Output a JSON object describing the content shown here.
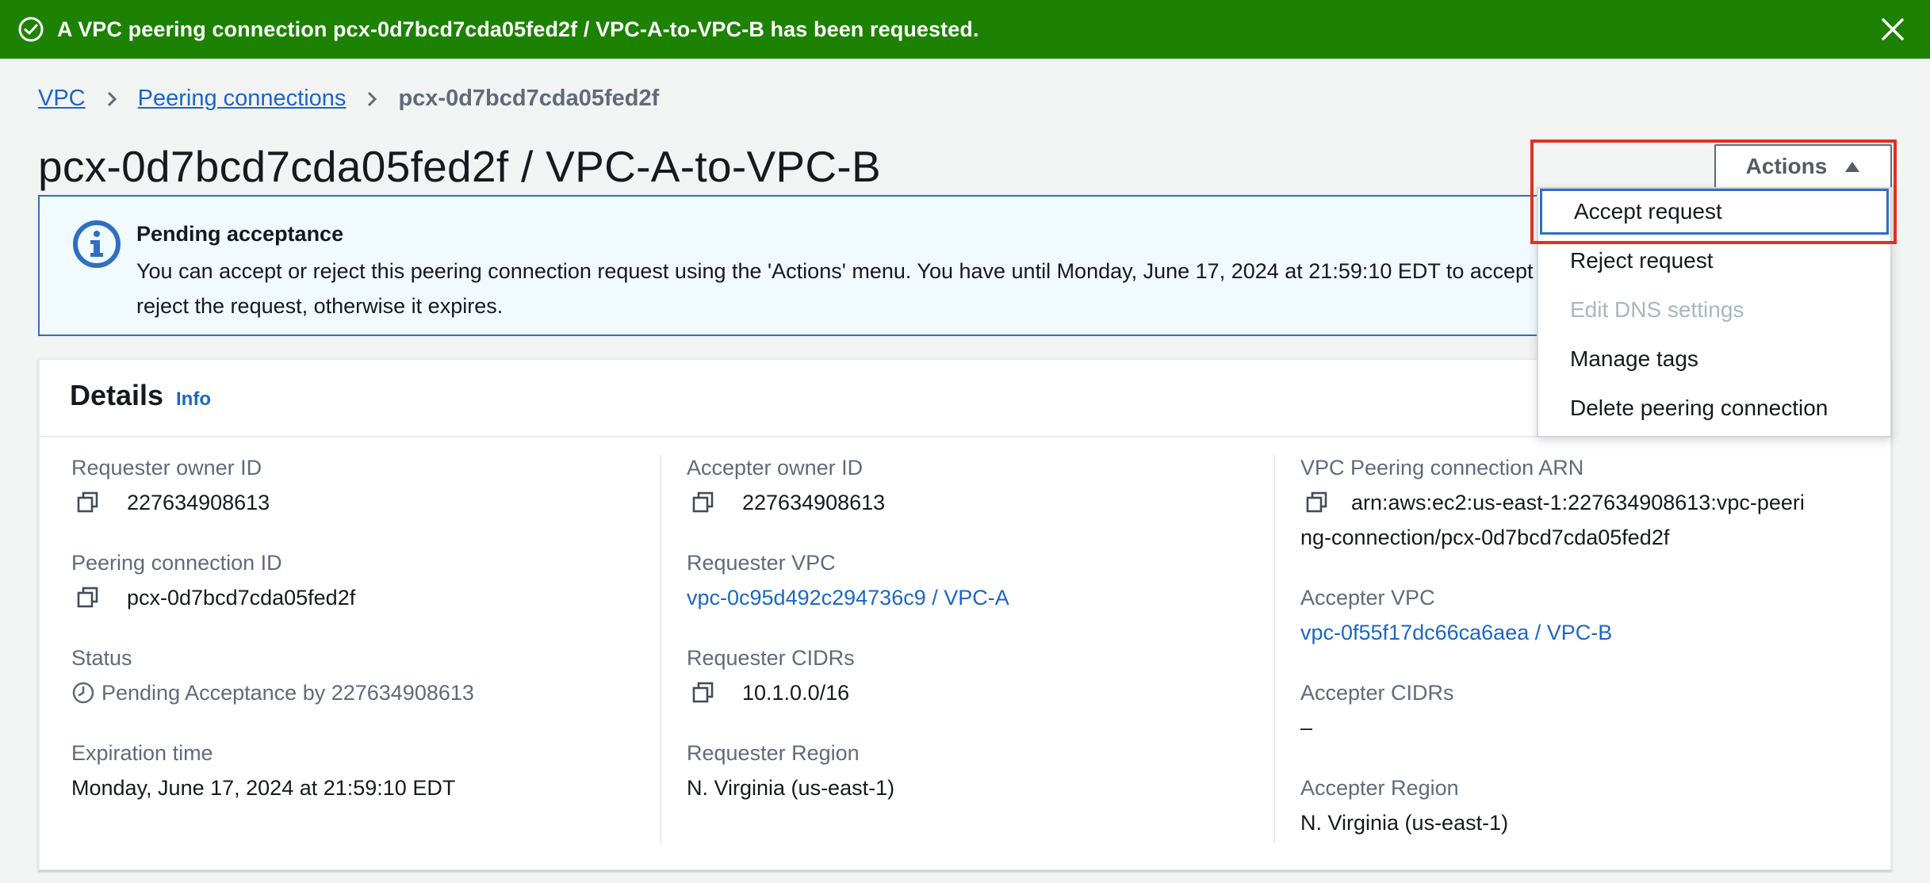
{
  "flash": {
    "message_prefix": "A VPC peering connection ",
    "message_id": "pcx-0d7bcd7cda05fed2f / VPC-A-to-VPC-B",
    "message_suffix": " has been requested.",
    "icon": "check-circle-icon",
    "color": "#1d8102"
  },
  "breadcrumb": {
    "items": [
      "VPC",
      "Peering connections"
    ],
    "current": "pcx-0d7bcd7cda05fed2f"
  },
  "page_title": "pcx-0d7bcd7cda05fed2f / VPC-A-to-VPC-B",
  "alert": {
    "title": "Pending acceptance",
    "body": "You can accept or reject this peering connection request using the 'Actions' menu. You have until Monday, June 17, 2024 at 21:59:10 EDT to accept or reject the request, otherwise it expires."
  },
  "actions": {
    "label": "Actions",
    "menu": [
      {
        "label": "Accept request",
        "disabled": false,
        "focused": true
      },
      {
        "label": "Reject request",
        "disabled": false
      },
      {
        "label": "Edit DNS settings",
        "disabled": true
      },
      {
        "label": "Manage tags",
        "disabled": false
      },
      {
        "label": "Delete peering connection",
        "disabled": false
      }
    ]
  },
  "details": {
    "heading": "Details",
    "info_link": "Info",
    "col1": {
      "requester_owner_id": {
        "label": "Requester owner ID",
        "value": "227634908613"
      },
      "peering_connection_id": {
        "label": "Peering connection ID",
        "value": "pcx-0d7bcd7cda05fed2f"
      },
      "status": {
        "label": "Status",
        "value": "Pending Acceptance by 227634908613"
      },
      "expiration_time": {
        "label": "Expiration time",
        "value": "Monday, June 17, 2024 at 21:59:10 EDT"
      }
    },
    "col2": {
      "accepter_owner_id": {
        "label": "Accepter owner ID",
        "value": "227634908613"
      },
      "requester_vpc": {
        "label": "Requester VPC",
        "value": "vpc-0c95d492c294736c9 / VPC-A"
      },
      "requester_cidrs": {
        "label": "Requester CIDRs",
        "value": "10.1.0.0/16"
      },
      "requester_region": {
        "label": "Requester Region",
        "value": "N. Virginia (us-east-1)"
      }
    },
    "col3": {
      "arn": {
        "label": "VPC Peering connection ARN",
        "value": "arn:aws:ec2:us-east-1:227634908613:vpc-peering-connection/pcx-0d7bcd7cda05fed2f"
      },
      "accepter_vpc": {
        "label": "Accepter VPC",
        "value": "vpc-0f55f17dc66ca6aea / VPC-B"
      },
      "accepter_cidrs": {
        "label": "Accepter CIDRs",
        "value": "–"
      },
      "accepter_region": {
        "label": "Accepter Region",
        "value": "N. Virginia (us-east-1)"
      }
    }
  },
  "colors": {
    "link": "#1b66c9",
    "highlight": "#e0311f",
    "info_border": "#2f6fbf"
  }
}
